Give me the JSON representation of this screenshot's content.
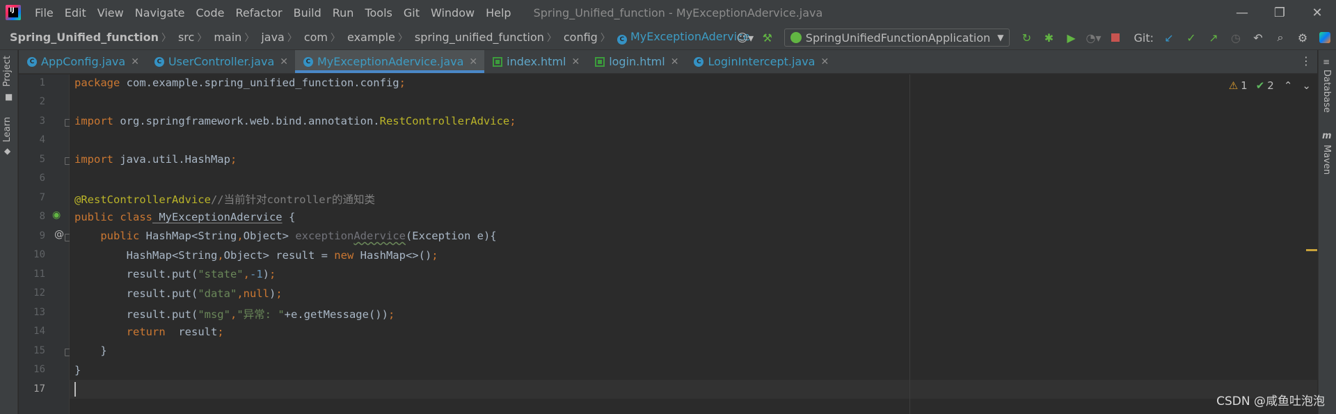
{
  "app": {
    "logo_text": "IJ",
    "window_title": "Spring_Unified_function - MyExceptionAdervice.java",
    "menu": [
      "File",
      "Edit",
      "View",
      "Navigate",
      "Code",
      "Refactor",
      "Build",
      "Run",
      "Tools",
      "Git",
      "Window",
      "Help"
    ]
  },
  "breadcrumb": [
    "Spring_Unified_function",
    "src",
    "main",
    "java",
    "com",
    "example",
    "spring_unified_function",
    "config",
    "MyExceptionAdervice"
  ],
  "toolbar": {
    "run_config": "SpringUnifiedFunctionApplication",
    "git_label": "Git:"
  },
  "tool_windows": {
    "left": [
      "Project",
      "Learn"
    ],
    "right": [
      "Database",
      "Maven"
    ]
  },
  "tabs": [
    {
      "label": "AppConfig.java",
      "type": "java",
      "active": false
    },
    {
      "label": "UserController.java",
      "type": "java",
      "active": false
    },
    {
      "label": "MyExceptionAdervice.java",
      "type": "java",
      "active": true
    },
    {
      "label": "index.html",
      "type": "html",
      "active": false
    },
    {
      "label": "login.html",
      "type": "html",
      "active": false
    },
    {
      "label": "LoginIntercept.java",
      "type": "java",
      "active": false
    }
  ],
  "editor": {
    "line_numbers": [
      "1",
      "2",
      "3",
      "4",
      "5",
      "6",
      "7",
      "8",
      "9",
      "10",
      "11",
      "12",
      "13",
      "14",
      "15",
      "16",
      "17"
    ],
    "code": {
      "l1_kw": "package",
      "l1_rest": " com.example.spring_unified_function.config",
      "l1_semi": ";",
      "l3_kw": "import",
      "l3_pkg": " org.springframework.web.bind.annotation.",
      "l3_cls": "RestControllerAdvice",
      "l3_semi": ";",
      "l5_kw": "import",
      "l5_rest": " java.util.HashMap",
      "l5_semi": ";",
      "l7_ann": "@RestControllerAdvice",
      "l7_cmt": "//当前针对controller的通知类",
      "l8_kw": "public class",
      "l8_name_a": " MyException",
      "l8_name_b": "Adervice",
      "l8_rest": " {",
      "l9_kw": "    public",
      "l9_type_a": " HashMap<String",
      "l9_comma": ",",
      "l9_type_b": "Object> ",
      "l9_method_a": "exception",
      "l9_method_b": "Adervice",
      "l9_rest": "(Exception e){",
      "l10_a": "        HashMap<String",
      "l10_comma": ",",
      "l10_b": "Object> result = ",
      "l10_new": "new",
      "l10_c": " HashMap<>()",
      "l10_semi": ";",
      "l11_a": "        result.put(",
      "l11_str": "\"state\"",
      "l11_comma": ",",
      "l11_num": "-1",
      "l11_b": ")",
      "l11_semi": ";",
      "l12_a": "        result.put(",
      "l12_str": "\"data\"",
      "l12_comma": ",",
      "l12_null": "null",
      "l12_b": ")",
      "l12_semi": ";",
      "l13_a": "        result.put(",
      "l13_str1": "\"msg\"",
      "l13_comma": ",",
      "l13_str2": "\"异常: \"",
      "l13_b": "+e.getMessage())",
      "l13_semi": ";",
      "l14_kw": "        return",
      "l14_rest": "  result",
      "l14_semi": ";",
      "l15": "    }",
      "l16": "}"
    },
    "inspections": {
      "warnings": "1",
      "weak_warnings": "2"
    }
  },
  "watermark": "CSDN @咸鱼吐泡泡"
}
